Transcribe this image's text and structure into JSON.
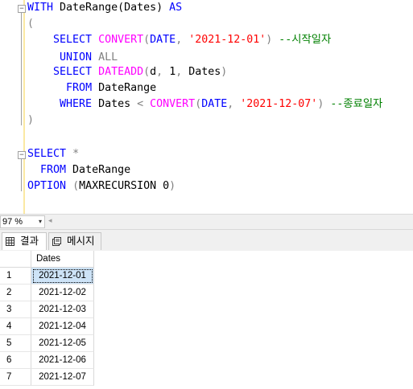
{
  "editor": {
    "lines": [
      [
        {
          "t": "WITH",
          "c": "kw"
        },
        {
          "t": " DateRange(Dates) ",
          "c": ""
        },
        {
          "t": "AS",
          "c": "kw"
        }
      ],
      [
        {
          "t": "(",
          "c": "op"
        }
      ],
      [
        {
          "t": "    ",
          "c": ""
        },
        {
          "t": "SELECT",
          "c": "kw"
        },
        {
          "t": " ",
          "c": ""
        },
        {
          "t": "CONVERT",
          "c": "fn"
        },
        {
          "t": "(",
          "c": "op"
        },
        {
          "t": "DATE",
          "c": "kw"
        },
        {
          "t": ", ",
          "c": "op"
        },
        {
          "t": "'2021-12-01'",
          "c": "str"
        },
        {
          "t": ") ",
          "c": "op"
        },
        {
          "t": "--시작일자",
          "c": "cm"
        }
      ],
      [
        {
          "t": "     ",
          "c": ""
        },
        {
          "t": "UNION",
          "c": "kw"
        },
        {
          "t": " ",
          "c": ""
        },
        {
          "t": "ALL",
          "c": "op"
        }
      ],
      [
        {
          "t": "    ",
          "c": ""
        },
        {
          "t": "SELECT",
          "c": "kw"
        },
        {
          "t": " ",
          "c": ""
        },
        {
          "t": "DATEADD",
          "c": "fn"
        },
        {
          "t": "(",
          "c": "op"
        },
        {
          "t": "d",
          "c": ""
        },
        {
          "t": ", ",
          "c": "op"
        },
        {
          "t": "1",
          "c": ""
        },
        {
          "t": ", ",
          "c": "op"
        },
        {
          "t": "Dates",
          "c": ""
        },
        {
          "t": ")",
          "c": "op"
        }
      ],
      [
        {
          "t": "      ",
          "c": ""
        },
        {
          "t": "FROM",
          "c": "kw"
        },
        {
          "t": " DateRange",
          "c": ""
        }
      ],
      [
        {
          "t": "     ",
          "c": ""
        },
        {
          "t": "WHERE",
          "c": "kw"
        },
        {
          "t": " Dates ",
          "c": ""
        },
        {
          "t": "<",
          "c": "op"
        },
        {
          "t": " ",
          "c": ""
        },
        {
          "t": "CONVERT",
          "c": "fn"
        },
        {
          "t": "(",
          "c": "op"
        },
        {
          "t": "DATE",
          "c": "kw"
        },
        {
          "t": ", ",
          "c": "op"
        },
        {
          "t": "'2021-12-07'",
          "c": "str"
        },
        {
          "t": ") ",
          "c": "op"
        },
        {
          "t": "--종료일자",
          "c": "cm"
        }
      ],
      [
        {
          "t": ")",
          "c": "op"
        }
      ],
      [],
      [
        {
          "t": "SELECT",
          "c": "kw"
        },
        {
          "t": " ",
          "c": ""
        },
        {
          "t": "*",
          "c": "op"
        }
      ],
      [
        {
          "t": "  ",
          "c": ""
        },
        {
          "t": "FROM",
          "c": "kw"
        },
        {
          "t": " DateRange",
          "c": ""
        }
      ],
      [
        {
          "t": "OPTION",
          "c": "kw"
        },
        {
          "t": " ",
          "c": ""
        },
        {
          "t": "(",
          "c": "op"
        },
        {
          "t": "MAXRECURSION ",
          "c": ""
        },
        {
          "t": "0",
          "c": ""
        },
        {
          "t": ")",
          "c": "op"
        }
      ]
    ]
  },
  "statusbar": {
    "zoom": "97 %",
    "zoom_arrow": "▾",
    "scroll_left": "◂"
  },
  "tabs": {
    "results_label": "결과",
    "messages_label": "메시지"
  },
  "grid": {
    "column_header": "Dates",
    "rows": [
      {
        "num": "1",
        "date": "2021-12-01"
      },
      {
        "num": "2",
        "date": "2021-12-02"
      },
      {
        "num": "3",
        "date": "2021-12-03"
      },
      {
        "num": "4",
        "date": "2021-12-04"
      },
      {
        "num": "5",
        "date": "2021-12-05"
      },
      {
        "num": "6",
        "date": "2021-12-06"
      },
      {
        "num": "7",
        "date": "2021-12-07"
      }
    ],
    "selected_row": 0
  }
}
